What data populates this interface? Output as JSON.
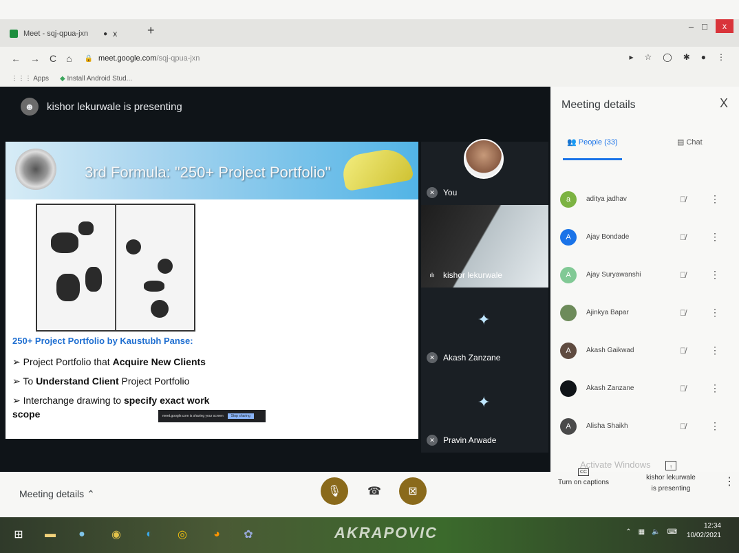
{
  "browser": {
    "tab_title": "Meet - sqj-qpua-jxn",
    "recording_dot": "●",
    "tab_close": "x",
    "new_tab": "+",
    "window_controls": [
      "–",
      "□",
      "x"
    ],
    "nav": [
      "←",
      "→",
      "C",
      "⌂"
    ],
    "url_host": "meet.google.com",
    "url_path": "/sqj-qpua-jxn",
    "bookmarks": [
      "Apps",
      "Install Android Stud..."
    ]
  },
  "stage": {
    "presenter_text": "kishor lekurwale is presenting"
  },
  "slide": {
    "title": "3rd Formula: \"250+ Project Portfolio\"",
    "portfolio_heading": "250+ Project Portfolio by Kaustubh Panse:",
    "bullets": [
      {
        "plain": "Project Portfolio that ",
        "bold": "Acquire New Clients",
        "tail": ""
      },
      {
        "plain": "To ",
        "bold": "Understand Client",
        "tail": " Project Portfolio"
      },
      {
        "plain": "Interchange drawing to ",
        "bold": "specify exact work scope",
        "tail": ""
      }
    ],
    "share_text": "meet.google.com is sharing your screen",
    "share_button": "Stop sharing"
  },
  "tiles": [
    {
      "name": "You"
    },
    {
      "name": "kishor lekurwale"
    },
    {
      "name": "Akash Zanzane"
    },
    {
      "name": "Pravin Arwade"
    }
  ],
  "panel": {
    "title": "Meeting details",
    "close": "X",
    "tab_people": "People (33)",
    "tab_chat": "Chat",
    "people": [
      {
        "initial": "a",
        "name": "aditya jadhav",
        "color": "#7cb342"
      },
      {
        "initial": "A",
        "name": "Ajay Bondade",
        "color": "#1a73e8"
      },
      {
        "initial": "A",
        "name": "Ajay Suryawanshi",
        "color": "#81c995"
      },
      {
        "initial": "",
        "name": "Ajinkya Bapar",
        "color": "#6d8b5a"
      },
      {
        "initial": "A",
        "name": "Akash Gaikwad",
        "color": "#5f4b40"
      },
      {
        "initial": "",
        "name": "Akash Zanzane",
        "color": "#101418"
      },
      {
        "initial": "A",
        "name": "Alisha Shaikh",
        "color": "#4a4a4a"
      }
    ]
  },
  "bottom": {
    "meeting_details": "Meeting details",
    "captions": "Turn on captions",
    "cc": "CC",
    "presenting_line1": "kishor lekurwale",
    "presenting_line2": "is presenting",
    "more": "⋮"
  },
  "taskbar": {
    "brand": "AKRAPOVIC",
    "time": "12:34",
    "date": "10/02/2021"
  },
  "watermark": "Activate Windows"
}
